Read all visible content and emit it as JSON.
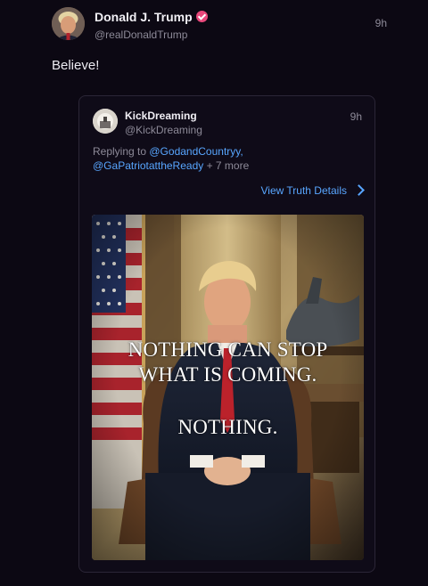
{
  "post": {
    "author": "Donald J. Trump",
    "handle": "@realDonaldTrump",
    "time": "9h",
    "text": "Believe!"
  },
  "quoted": {
    "author": "KickDreaming",
    "handle": "@KickDreaming",
    "time": "9h",
    "replying_prefix": "Replying to ",
    "mention_1": "@GodandCountryy,",
    "mention_2": "@GaPatriotattheReady",
    "more": " + 7 more",
    "details_label": "View Truth Details",
    "image_overlay": {
      "line1": "NOTHING CAN STOP",
      "line2": "WHAT IS COMING.",
      "line3": "NOTHING."
    }
  },
  "colors": {
    "background": "#0c0813",
    "card_border": "#2b2637",
    "link": "#58a6ff",
    "verified": "#e8487b",
    "muted": "#8d8a98"
  }
}
